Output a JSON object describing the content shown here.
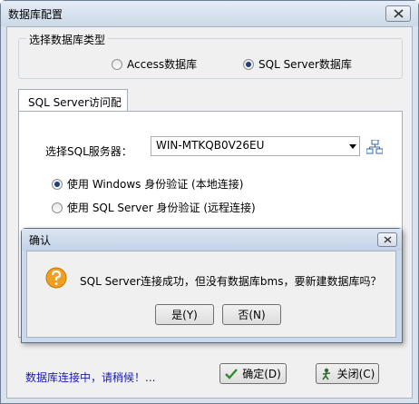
{
  "window": {
    "title": "数据库配置"
  },
  "db_type": {
    "legend": "选择数据库类型",
    "options": [
      {
        "label": "Access数据库",
        "checked": false
      },
      {
        "label": "SQL Server数据库",
        "checked": true
      }
    ]
  },
  "tab": {
    "label": "SQL Server访问配置"
  },
  "sql_config": {
    "server_label": "选择SQL服务器：",
    "server_value": "WIN-MTKQB0V26EU",
    "auth_options": [
      {
        "label": "使用 Windows 身份验证  (本地连接)",
        "checked": true
      },
      {
        "label": "使用 SQL Server 身份验证 (远程连接)",
        "checked": false
      }
    ]
  },
  "status": {
    "text": "数据库连接中，请稍候！..."
  },
  "buttons": {
    "confirm": "确定(D)",
    "close": "关闭(C)"
  },
  "dialog": {
    "title": "确认",
    "message": "SQL Server连接成功，但没有数据库bms，要新建数据库吗？",
    "yes": "是(Y)",
    "no": "否(N)"
  },
  "colors": {
    "status_text": "#1a1ab4",
    "check_green": "#2e8b2e",
    "question_orange": "#f0a020"
  }
}
